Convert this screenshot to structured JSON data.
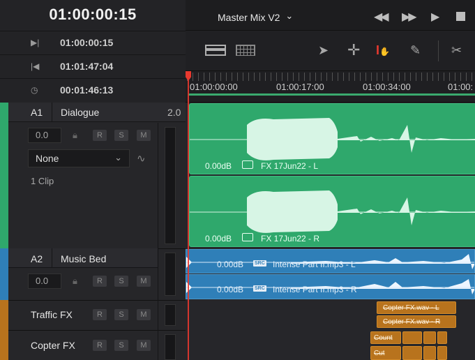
{
  "header": {
    "timecode": "01:00:00:15",
    "rows": [
      {
        "icon": "in-point-icon",
        "glyph": "▶|",
        "value": "01:00:00:15"
      },
      {
        "icon": "out-point-icon",
        "glyph": "|◀",
        "value": "01:01:47:04"
      },
      {
        "icon": "duration-clock-icon",
        "glyph": "◷",
        "value": "00:01:46:13"
      }
    ]
  },
  "topbar": {
    "mix_title": "Master Mix V2",
    "dropdown_glyph": "⌄"
  },
  "ruler": {
    "labels": [
      "01:00:00:00",
      "01:00:17:00",
      "01:00:34:00",
      "01:00:"
    ]
  },
  "tracks": {
    "a1": {
      "id": "A1",
      "name": "Dialogue",
      "format": "2.0",
      "volume": "0.0",
      "send": "None",
      "clip_count": "1 Clip",
      "buttons": [
        "R",
        "S",
        "M"
      ]
    },
    "a2": {
      "id": "A2",
      "name": "Music Bed",
      "volume": "0.0",
      "buttons": [
        "R",
        "S",
        "M"
      ]
    },
    "a3": {
      "name": "Traffic FX",
      "buttons": [
        "R",
        "S",
        "M"
      ]
    },
    "a4": {
      "name": "Copter FX",
      "buttons": [
        "R",
        "S",
        "M"
      ]
    }
  },
  "clips": {
    "dialogue_l": {
      "gain": "0.00dB",
      "name": "FX 17Jun22 - L"
    },
    "dialogue_r": {
      "gain": "0.00dB",
      "name": "FX 17Jun22 - R"
    },
    "music_l": {
      "gain": "0.00dB",
      "badge": "SRC",
      "name": "Intense Part II.mp3 - L"
    },
    "music_r": {
      "gain": "0.00dB",
      "badge": "SRC",
      "name": "Intense Part II.mp3 - R"
    },
    "copter_l": {
      "name": "Copter FX.wav - L"
    },
    "copter_r": {
      "name": "Copter FX.wav - R"
    },
    "copter_small_1": {
      "name": "Count"
    },
    "copter_small_2": {
      "name": "Cut"
    }
  },
  "colors": {
    "dialogue": "#2fa86c",
    "music": "#2f7fb8",
    "fx": "#b8731d",
    "playhead": "#e8392f"
  }
}
